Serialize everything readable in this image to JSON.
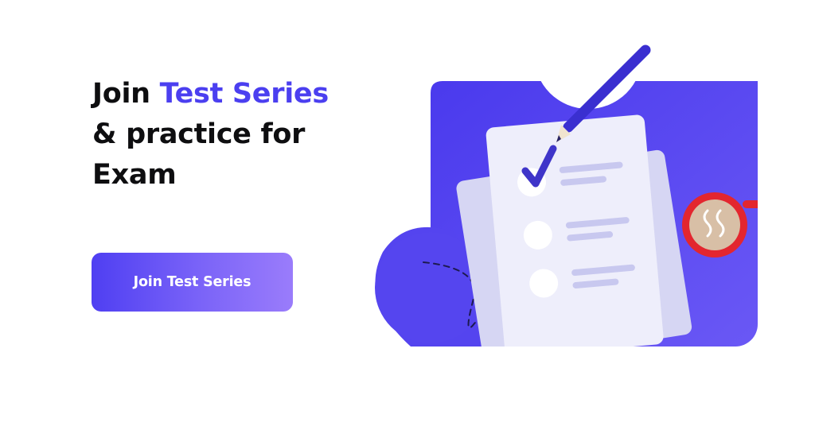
{
  "banner": {
    "headline_prefix": "Join ",
    "headline_accent": "Test Series",
    "headline_line2": "& practice for",
    "headline_line3": "Exam",
    "cta_label": "Join Test Series"
  },
  "colors": {
    "accent": "#4b3ff0",
    "cta_gradient_start": "#4f3ff2",
    "cta_gradient_end": "#9a7cfb",
    "card_background": "#ffffff",
    "mug_red": "#e3262f"
  },
  "illustration": {
    "icons": [
      "pencil-icon",
      "checkmark-icon",
      "coffee-mug-icon",
      "dashed-path-icon"
    ]
  }
}
